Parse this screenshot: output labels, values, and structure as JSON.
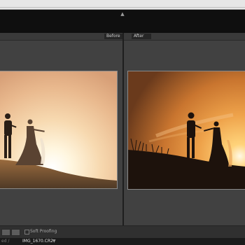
{
  "view": {
    "before_label": "Before",
    "after_label": "After",
    "panel_toggle_icon": "triangle-up-icon"
  },
  "toolbar": {
    "soft_proofing_label": "Soft Proofing",
    "soft_proofing_checked": false
  },
  "status": {
    "path_prefix": "ed /",
    "filename": "IMG_1670.CR2",
    "dropdown_icon": "caret-down-icon"
  }
}
